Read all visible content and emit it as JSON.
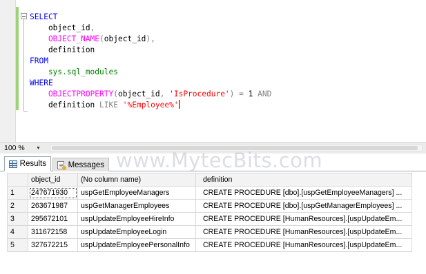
{
  "editor": {
    "lines": [
      [
        {
          "t": "SELECT",
          "c": "kw"
        }
      ],
      [
        {
          "t": "    object_id",
          "c": ""
        },
        {
          "t": ",",
          "c": "gr"
        }
      ],
      [
        {
          "t": "    OBJECT_NAME",
          "c": "fn"
        },
        {
          "t": "(",
          "c": "gr"
        },
        {
          "t": "object_id",
          "c": ""
        },
        {
          "t": "),",
          "c": "gr"
        }
      ],
      [
        {
          "t": "    definition",
          "c": ""
        }
      ],
      [
        {
          "t": "FROM",
          "c": "kw"
        }
      ],
      [
        {
          "t": "    sys.sql_modules",
          "c": "sys"
        }
      ],
      [
        {
          "t": "WHERE",
          "c": "kw"
        }
      ],
      [
        {
          "t": "    OBJECTPROPERTY",
          "c": "fn"
        },
        {
          "t": "(",
          "c": "gr"
        },
        {
          "t": "object_id",
          "c": ""
        },
        {
          "t": ", ",
          "c": "gr"
        },
        {
          "t": "'IsProcedure'",
          "c": "str"
        },
        {
          "t": ") = ",
          "c": "gr"
        },
        {
          "t": "1",
          "c": ""
        },
        {
          "t": " AND",
          "c": "gr"
        }
      ],
      [
        {
          "t": "    definition ",
          "c": ""
        },
        {
          "t": "LIKE",
          "c": "gr"
        },
        {
          "t": " ",
          "c": ""
        },
        {
          "t": "'%Employee%'",
          "c": "str"
        }
      ]
    ],
    "caret_line": 8
  },
  "zoom": {
    "value": "100 %"
  },
  "tabs": {
    "results_label": "Results",
    "messages_label": "Messages"
  },
  "watermark": "www.MytecBits.com",
  "grid": {
    "columns": [
      "object_id",
      "(No column name)",
      "definition"
    ],
    "rows": [
      {
        "n": "1",
        "object_id": "247671930",
        "name": "uspGetEmployeeManagers",
        "definition": "CREATE PROCEDURE [dbo].[uspGetEmployeeManagers] ..."
      },
      {
        "n": "2",
        "object_id": "263671987",
        "name": "uspGetManagerEmployees",
        "definition": "CREATE PROCEDURE [dbo].[uspGetManagerEmployees] ..."
      },
      {
        "n": "3",
        "object_id": "295672101",
        "name": "uspUpdateEmployeeHireInfo",
        "definition": "CREATE PROCEDURE [HumanResources].[uspUpdateEm..."
      },
      {
        "n": "4",
        "object_id": "311672158",
        "name": "uspUpdateEmployeeLogin",
        "definition": "CREATE PROCEDURE [HumanResources].[uspUpdateEm..."
      },
      {
        "n": "5",
        "object_id": "327672215",
        "name": "uspUpdateEmployeePersonalInfo",
        "definition": "CREATE PROCEDURE [HumanResources].[uspUpdateEm..."
      }
    ]
  },
  "colors": {
    "keyword": "#0000ff",
    "function": "#ff00ff",
    "system_object": "#008000",
    "string": "#ff0000",
    "operator": "#808080",
    "change_marker": "#9ed27a"
  }
}
